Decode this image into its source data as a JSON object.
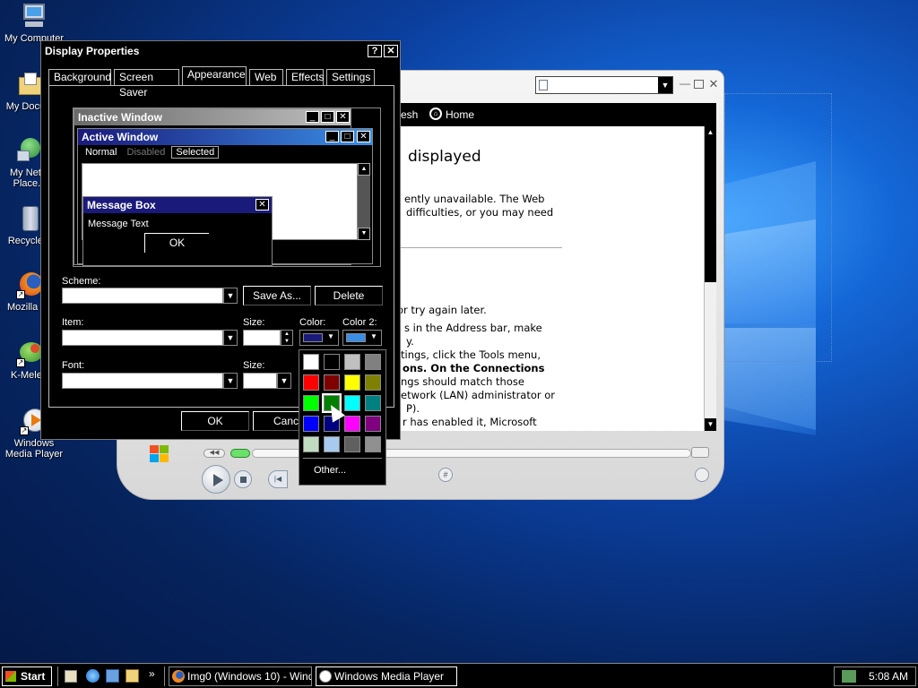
{
  "desktop": {
    "icons": [
      {
        "label": "My Computer",
        "icon": "computer-icon"
      },
      {
        "label": "My Docu...",
        "icon": "documents-folder-icon"
      },
      {
        "label": "My Net... Place...",
        "icon": "network-places-icon"
      },
      {
        "label": "Recycle...",
        "icon": "recycle-bin-icon"
      },
      {
        "label": "Mozilla F...",
        "icon": "firefox-icon"
      },
      {
        "label": "K-Mele...",
        "icon": "k-meleon-icon"
      },
      {
        "label": "Windows Media Player",
        "icon": "media-player-icon"
      }
    ]
  },
  "media_player": {
    "toolbar": {
      "refresh_label": "esh",
      "home_label": "Home"
    },
    "page": {
      "heading": "displayed",
      "lines": [
        "ently unavailable. The Web",
        "difficulties, or you may need",
        "or try again later.",
        "s in the Address bar, make",
        "y.",
        "tings, click the Tools menu,",
        "ons. On the Connections",
        "ngs should match those",
        "etwork (LAN) administrator or",
        "P).",
        "r has enabled it, Microsoft"
      ]
    }
  },
  "display_properties": {
    "title": "Display Properties",
    "help_label": "?",
    "close_label": "✕",
    "tabs": [
      "Background",
      "Screen Saver",
      "Appearance",
      "Web",
      "Effects",
      "Settings"
    ],
    "active_tab": "Appearance",
    "preview": {
      "inactive_title": "Inactive Window",
      "active_title": "Active Window",
      "menu": [
        "Normal",
        "Disabled",
        "Selected"
      ],
      "message_box_title": "Message Box",
      "message_text": "Message Text",
      "ok_label": "OK"
    },
    "scheme_label": "Scheme:",
    "save_as_label": "Save As...",
    "delete_label": "Delete",
    "item_label": "Item:",
    "size_label": "Size:",
    "color_label": "Color:",
    "color2_label": "Color 2:",
    "font_label": "Font:",
    "font_size_label": "Size:",
    "ok_label": "OK",
    "cancel_label": "Cance",
    "color_value": "#1a1a7a",
    "color2_value": "#3a8ee6"
  },
  "color_picker": {
    "swatches": [
      "#ffffff",
      "#000000",
      "#c0c0c0",
      "#808080",
      "#ff0000",
      "#800000",
      "#ffff00",
      "#808000",
      "#00ff00",
      "#008000",
      "#00ffff",
      "#008080",
      "#0000ff",
      "#000080",
      "#ff00ff",
      "#800080",
      "#c0dcc0",
      "#a6caf0",
      "#606060",
      "#909090"
    ],
    "selected_index": 9,
    "other_label": "Other..."
  },
  "taskbar": {
    "start_label": "Start",
    "tasks": [
      {
        "label": "Img0 (Windows 10) - Wind...",
        "icon": "firefox-icon"
      },
      {
        "label": "Windows Media Player",
        "icon": "media-player-icon"
      }
    ],
    "chevron_label": "»",
    "clock": "5:08 AM"
  }
}
